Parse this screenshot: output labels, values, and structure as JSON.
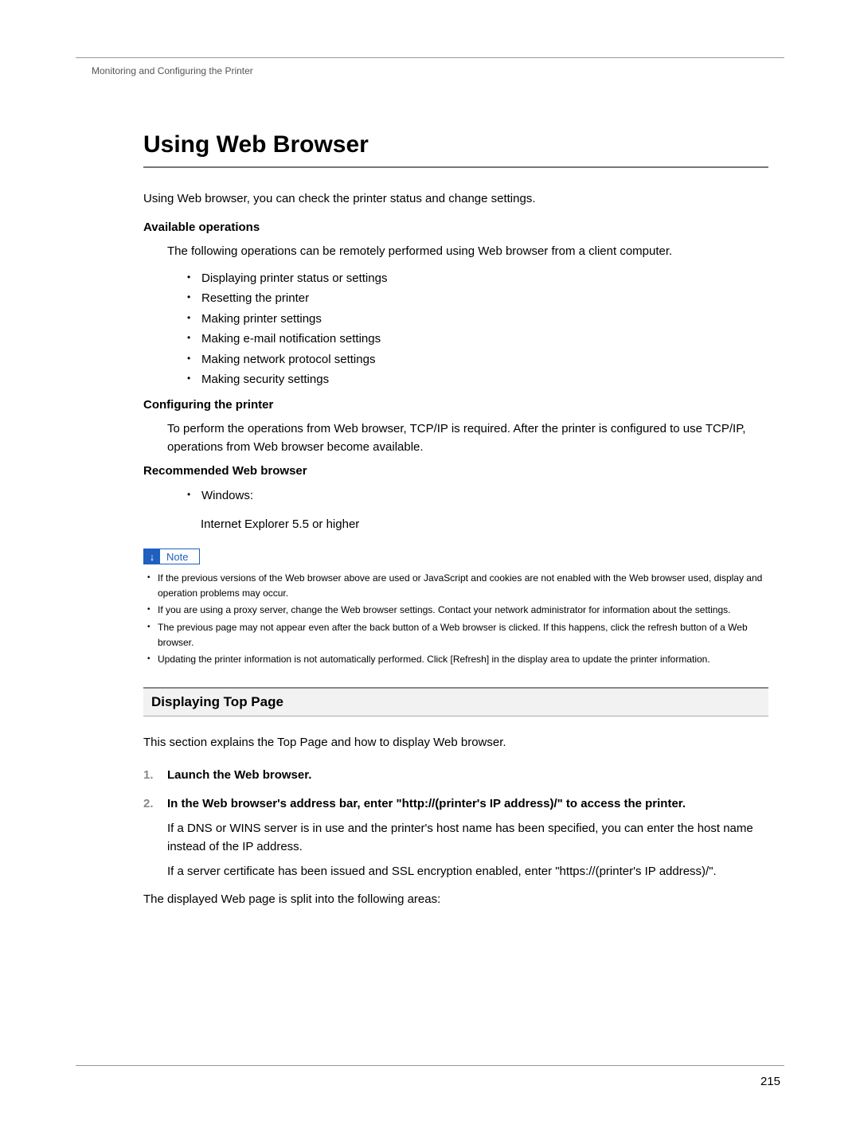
{
  "running_header": "Monitoring and Configuring the Printer",
  "page_number": "215",
  "title": "Using Web Browser",
  "intro": "Using Web browser, you can check the printer status and change settings.",
  "sections": {
    "available_ops": {
      "heading": "Available operations",
      "text": "The following operations can be remotely performed using Web browser from a client computer.",
      "items": [
        "Displaying printer status or settings",
        "Resetting the printer",
        "Making printer settings",
        "Making e-mail notification settings",
        "Making network protocol settings",
        "Making security settings"
      ]
    },
    "configuring": {
      "heading": "Configuring the printer",
      "text": "To perform the operations from Web browser, TCP/IP is required. After the printer is configured to use TCP/IP, operations from Web browser become available."
    },
    "recommended": {
      "heading": "Recommended Web browser",
      "items": [
        "Windows:"
      ],
      "subtext": "Internet Explorer 5.5 or higher"
    }
  },
  "note": {
    "label": "Note",
    "items": [
      "If the previous versions of the Web browser above are used or JavaScript and cookies are not enabled with the Web browser used, display and operation problems may occur.",
      "If you are using a proxy server, change the Web browser settings. Contact your network administrator for information about the settings.",
      "The previous page may not appear even after the back button of a Web browser is clicked. If this happens, click the refresh button of a Web browser.",
      "Updating the printer information is not automatically performed. Click [Refresh] in the display area to update the printer information."
    ]
  },
  "subsection": {
    "title": "Displaying Top Page",
    "intro": "This section explains the Top Page and how to display Web browser.",
    "steps": [
      {
        "num": "1.",
        "title": "Launch the Web browser.",
        "body1": "",
        "body2": ""
      },
      {
        "num": "2.",
        "title": "In the Web browser's address bar, enter \"http://(printer's IP address)/\" to access the printer.",
        "body1": "If a DNS or WINS server is in use and the printer's host name has been specified, you can enter the host name instead of the IP address.",
        "body2": "If a server certificate has been issued and SSL encryption enabled, enter \"https://(printer's IP address)/\"."
      }
    ],
    "closing": "The displayed Web page is split into the following areas:"
  }
}
